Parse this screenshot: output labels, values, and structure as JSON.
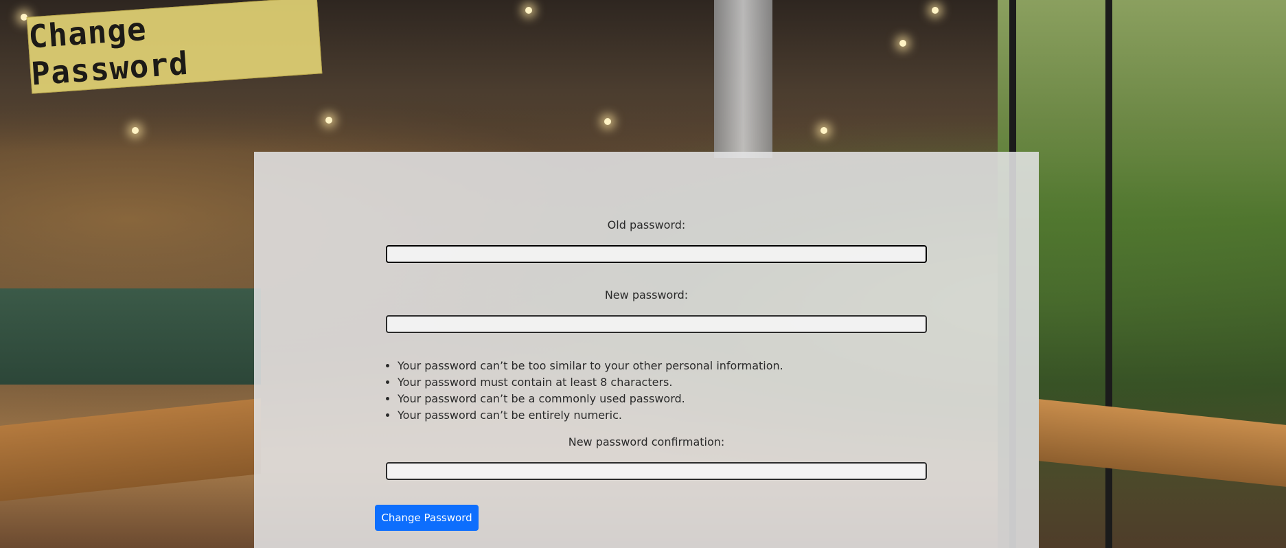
{
  "page": {
    "title": "Change Password"
  },
  "form": {
    "old_password": {
      "label": "Old password:",
      "value": ""
    },
    "new_password": {
      "label": "New password:",
      "value": ""
    },
    "help_rules": [
      "Your password can’t be too similar to your other personal information.",
      "Your password must contain at least 8 characters.",
      "Your password can’t be a commonly used password.",
      "Your password can’t be entirely numeric."
    ],
    "confirm_password": {
      "label": "New password confirmation:",
      "value": ""
    },
    "submit_label": "Change Password"
  },
  "colors": {
    "button_primary": "#0d6efd",
    "title_tag": "#e4d576",
    "panel": "#e2e2e4"
  }
}
